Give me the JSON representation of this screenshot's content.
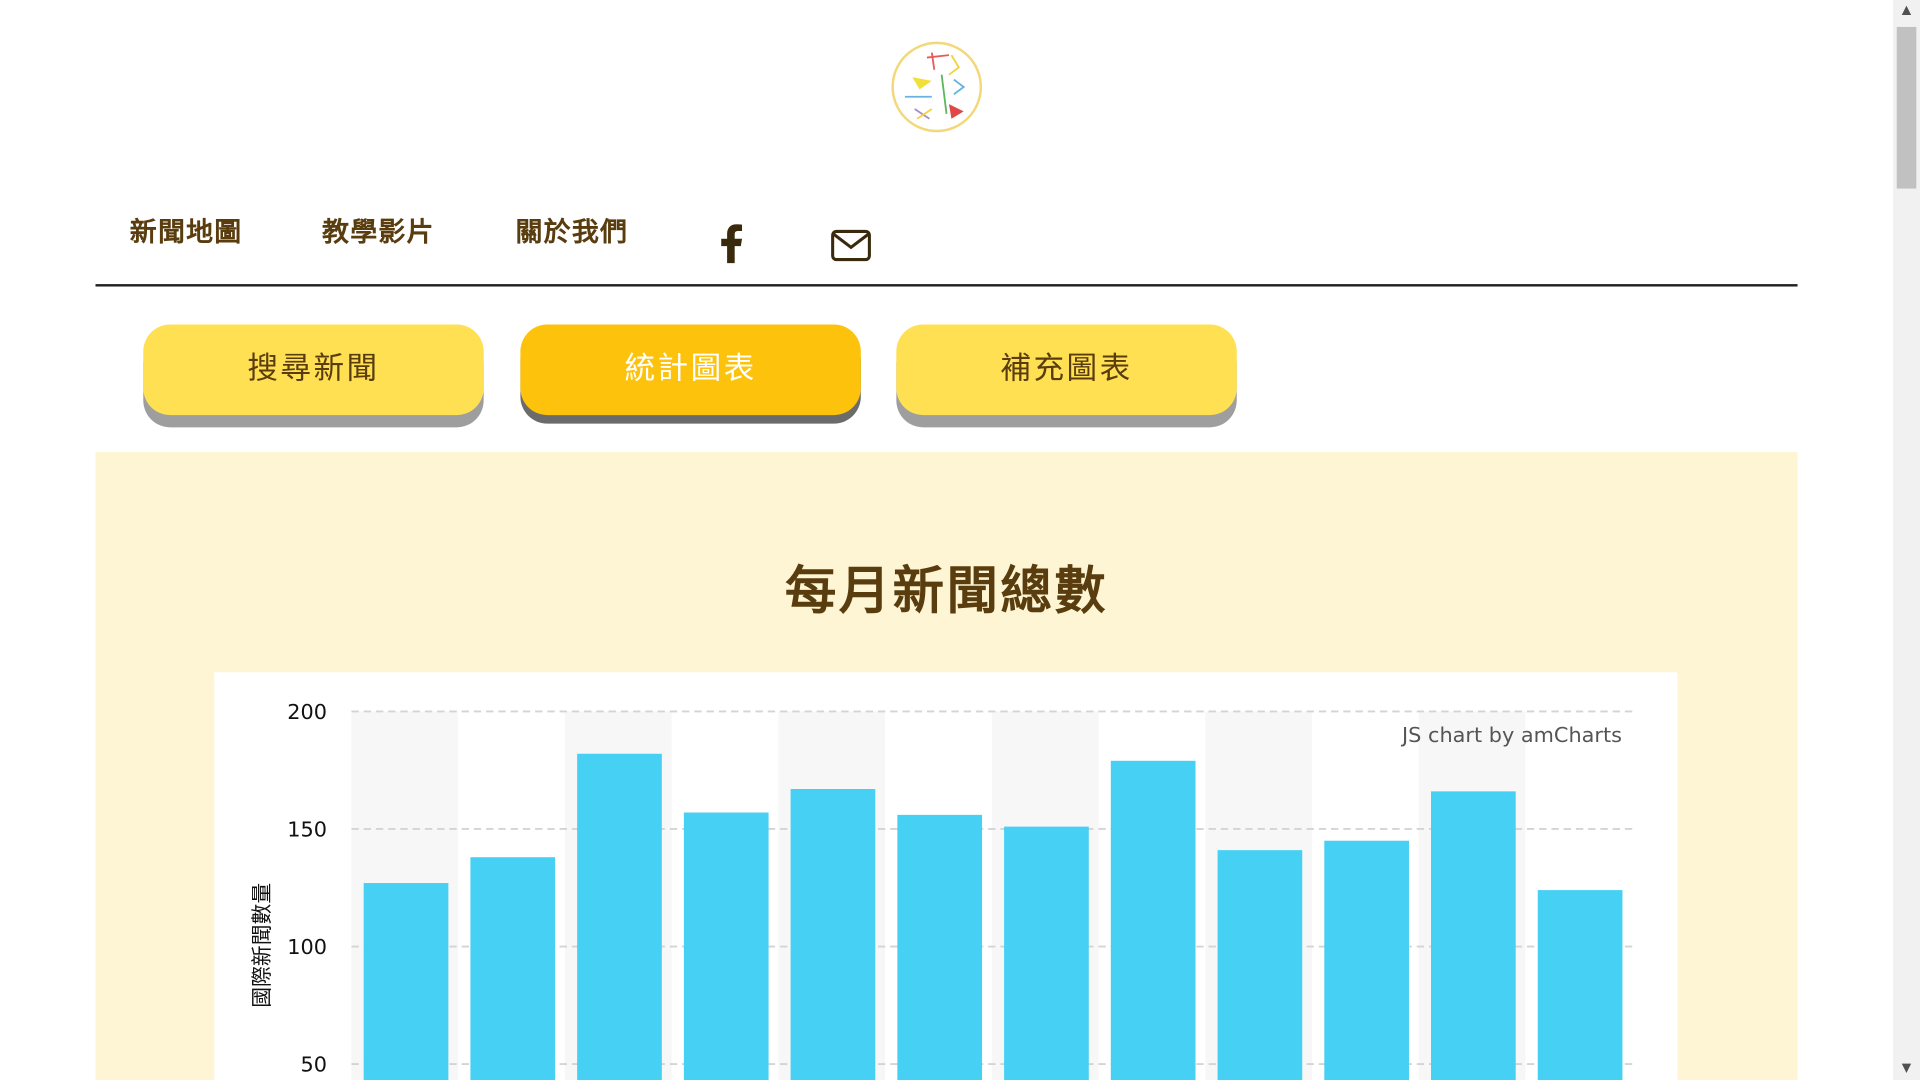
{
  "nav": {
    "items": [
      {
        "label": "新聞地圖"
      },
      {
        "label": "教學影片"
      },
      {
        "label": "關於我們"
      }
    ],
    "icons": [
      "facebook-icon",
      "mail-icon"
    ]
  },
  "tabs": [
    {
      "label": "搜尋新聞",
      "active": false
    },
    {
      "label": "統計圖表",
      "active": true
    },
    {
      "label": "補充圖表",
      "active": false
    }
  ],
  "panel": {
    "title": "每月新聞總數",
    "credit": "JS chart by amCharts"
  },
  "colors": {
    "tab_inactive": "#ffe052",
    "tab_active": "#fdc20c",
    "panel_bg": "#fdf5d3",
    "bar": "#46d0f4",
    "text_brown": "#5a3d0f"
  },
  "chart_data": {
    "type": "bar",
    "ylabel": "國際新聞數量",
    "ylim": [
      50,
      200
    ],
    "yticks": [
      50,
      100,
      150,
      200
    ],
    "grid": true,
    "values": [
      127,
      138,
      182,
      157,
      167,
      156,
      151,
      179,
      141,
      145,
      166,
      124
    ]
  }
}
